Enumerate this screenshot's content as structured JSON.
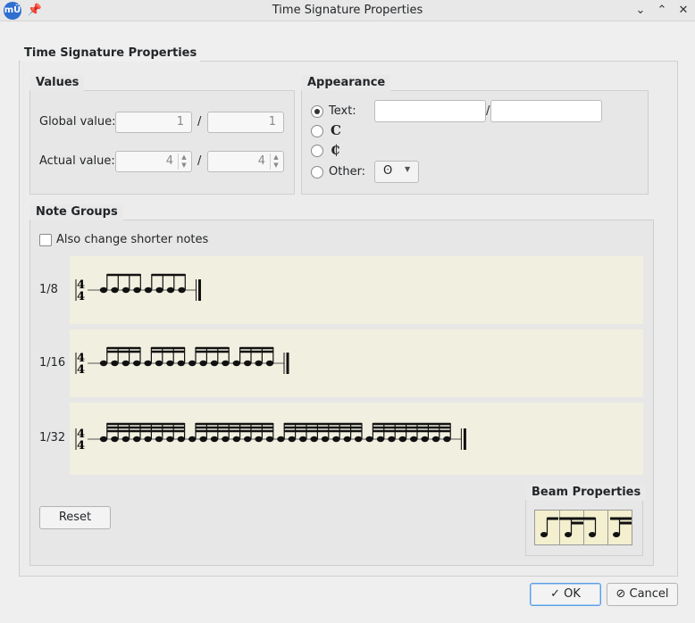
{
  "window": {
    "title": "Time Signature Properties",
    "app_icon_text": "mÜ"
  },
  "main_group": {
    "title": "Time Signature Properties"
  },
  "values": {
    "title": "Values",
    "global_label": "Global value:",
    "global_numerator": "1",
    "global_denominator": "1",
    "actual_label": "Actual value:",
    "actual_numerator": "4",
    "actual_denominator": "4",
    "separator": "/"
  },
  "appearance": {
    "title": "Appearance",
    "text_label": "Text:",
    "text_numerator": "",
    "text_denominator": "",
    "separator": "/",
    "common_time_symbol": "𝄴",
    "cut_time_symbol": "𝄵",
    "other_label": "Other:",
    "other_selected": "ʘ",
    "selected_option": "text"
  },
  "note_groups": {
    "title": "Note Groups",
    "also_change_label": "Also change shorter notes",
    "also_change_checked": false,
    "rows": [
      {
        "label": "1/8",
        "notes": 8,
        "beams": 1
      },
      {
        "label": "1/16",
        "notes": 16,
        "beams": 2
      },
      {
        "label": "1/32",
        "notes": 32,
        "beams": 3
      }
    ],
    "reset_label": "Reset"
  },
  "beam_properties": {
    "title": "Beam Properties"
  },
  "footer": {
    "ok_label": "OK",
    "cancel_label": "Cancel"
  }
}
